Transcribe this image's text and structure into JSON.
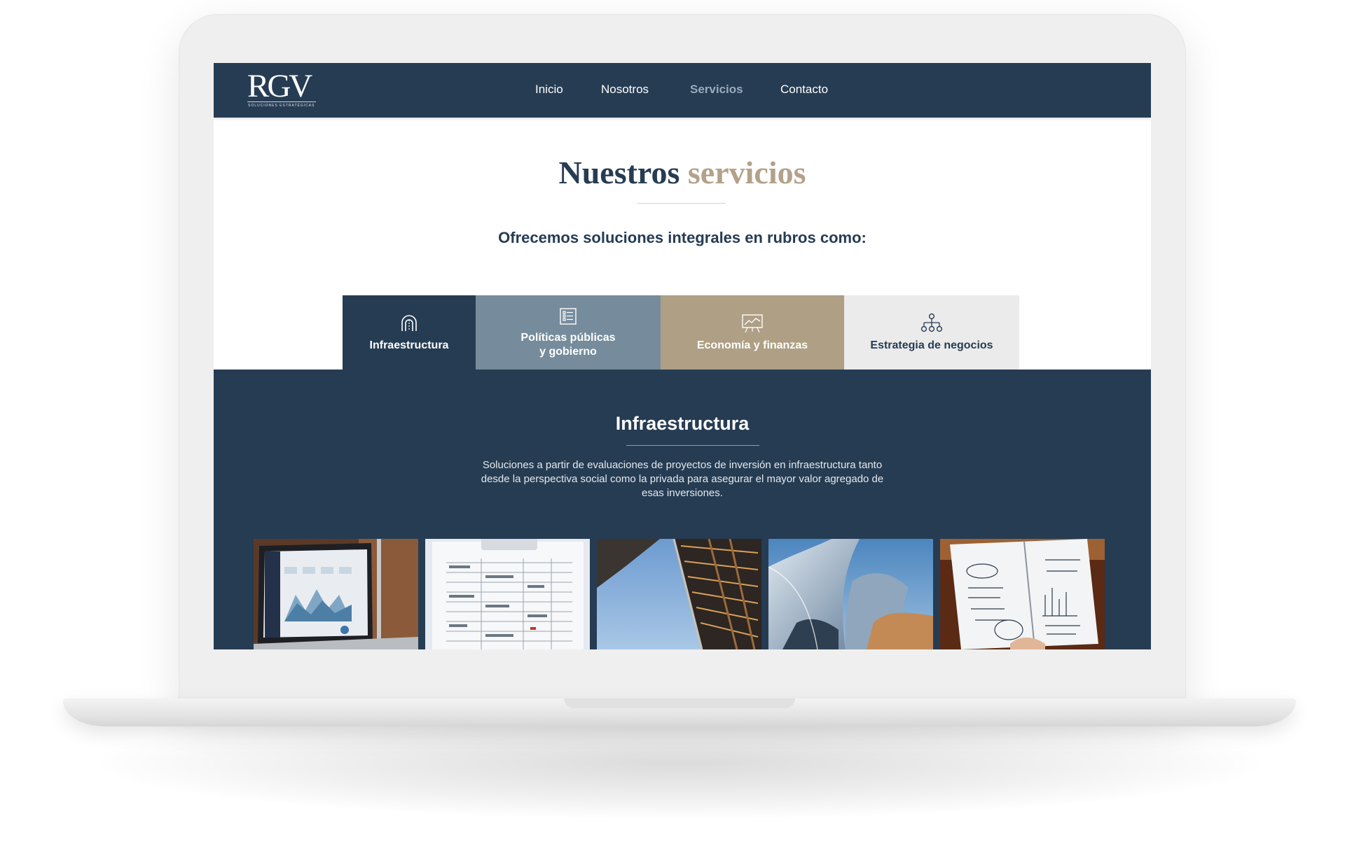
{
  "brand": {
    "logo_text": "RGV",
    "logo_subtitle": "SOLUCIONES ESTRATÉGICAS"
  },
  "nav": {
    "items": [
      {
        "label": "Inicio",
        "active": false
      },
      {
        "label": "Nosotros",
        "active": false
      },
      {
        "label": "Servicios",
        "active": true
      },
      {
        "label": "Contacto",
        "active": false
      }
    ]
  },
  "hero": {
    "title_main": "Nuestros",
    "title_accent": "servicios",
    "lead": "Ofrecemos soluciones integrales en rubros como:"
  },
  "tabs": [
    {
      "line1": "Infraestructura",
      "line2": "",
      "icon": "arch-icon",
      "active": true
    },
    {
      "line1": "Políticas públicas",
      "line2": "y gobierno",
      "icon": "checklist-icon",
      "active": false
    },
    {
      "line1": "Economía y finanzas",
      "line2": "",
      "icon": "chart-presentation-icon",
      "active": false
    },
    {
      "line1": "Estrategia de negocios",
      "line2": "",
      "icon": "org-chart-icon",
      "active": false
    }
  ],
  "panel": {
    "title": "Infraestructura",
    "description": "Soluciones a partir de evaluaciones de proyectos de inversión en infraestructura tanto desde la perspectiva social como la privada para asegurar el mayor valor agregado de esas inversiones."
  },
  "photos": [
    {
      "name": "laptop-dashboard-photo"
    },
    {
      "name": "clipboard-document-photo"
    },
    {
      "name": "building-facade-sky-photo"
    },
    {
      "name": "curved-metal-building-photo"
    },
    {
      "name": "notebook-sketches-photo"
    }
  ],
  "colors": {
    "navy": "#263c53",
    "slate": "#768c9c",
    "sand": "#ae9f85",
    "light_gray": "#ebebeb",
    "accent_text": "#b3a189"
  }
}
